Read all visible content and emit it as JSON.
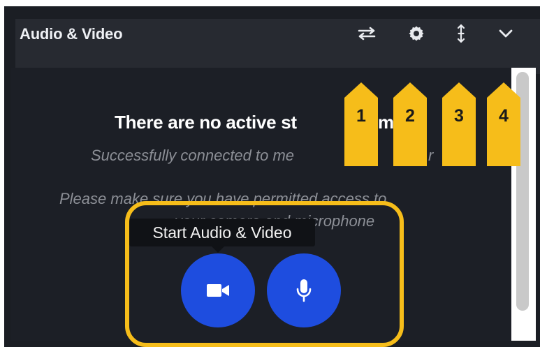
{
  "window": {
    "title": "Audio & Video"
  },
  "header": {
    "buttons": [
      {
        "icon": "swap-arrows-icon"
      },
      {
        "icon": "gear-icon"
      },
      {
        "icon": "vertical-resize-icon"
      },
      {
        "icon": "chevron-down-icon"
      }
    ]
  },
  "message": {
    "title": "There are no active st",
    "title_tail": "m",
    "line1": "Successfully connected to me",
    "line1_tail": "r",
    "line2": "Please make sure you have permitted access to",
    "line3": "your camera and microphone"
  },
  "tooltip": {
    "text": "Start Audio & Video"
  },
  "media_buttons": [
    {
      "icon": "video-camera-icon"
    },
    {
      "icon": "microphone-icon"
    }
  ],
  "markers": [
    "1",
    "2",
    "3",
    "4"
  ],
  "colors": {
    "panel_bg": "#1b1e24",
    "header_bg": "#272a31",
    "button_blue": "#1e4ddf",
    "highlight": "#f6bd1a",
    "marker": "#f6bd1a"
  }
}
